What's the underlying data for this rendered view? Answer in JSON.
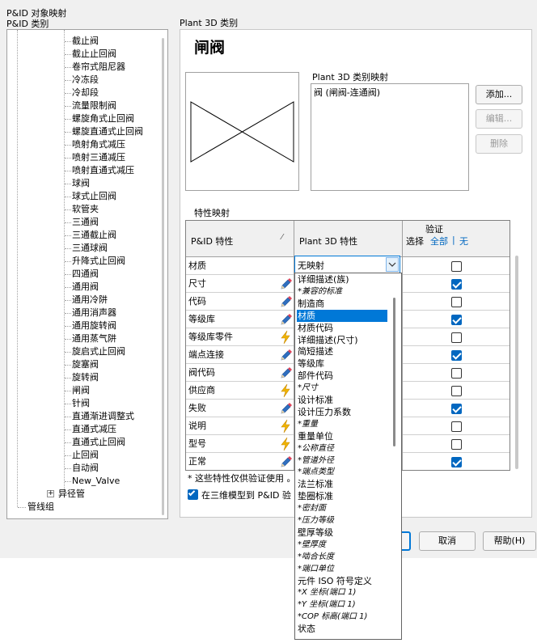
{
  "window": {
    "title": "P&ID 对象映射"
  },
  "left": {
    "header": "P&ID 类别",
    "tree_items": [
      "截止阀",
      "截止止回阀",
      "卷帘式阻尼器",
      "冷冻段",
      "冷却段",
      "流量限制阀",
      "螺旋角式止回阀",
      "螺旋直通式止回阀",
      "喷射角式减压",
      "喷射三通减压",
      "喷射直通式减压",
      "球阀",
      "球式止回阀",
      "软管夹",
      "三通阀",
      "三通截止阀",
      "三通球阀",
      "升降式止回阀",
      "四通阀",
      "通用阀",
      "通用冷阱",
      "通用消声器",
      "通用旋转阀",
      "通用蒸气阱",
      "旋启式止回阀",
      "旋塞阀",
      "旋转阀",
      "闸阀",
      "针阀",
      "直通渐进调整式",
      "直通式减压",
      "直通式止回阀",
      "止回阀",
      "自动阀",
      "New_Valve"
    ],
    "reducer": "异径管",
    "pipeline_group": "管线组",
    "expand_symbol": "+"
  },
  "right": {
    "header": "Plant 3D 类别",
    "class_title": "闸阀",
    "mapping_label": "Plant 3D 类别映射",
    "mapping_items": [
      "阀 (闸阀-连通阀)"
    ],
    "buttons": {
      "add": "添加...",
      "edit": "编辑...",
      "delete": "删除"
    },
    "prop_mapping_label": "特性映射",
    "grid": {
      "col1": "P&ID 特性",
      "col2": "Plant 3D 特性",
      "col3": "验证",
      "select_label": "选择",
      "select_all": "全部",
      "select_sep": "|",
      "select_none": "无",
      "rows": [
        {
          "name": "材质",
          "icon": "",
          "checked": false
        },
        {
          "name": "尺寸",
          "icon": "pencil-icon",
          "checked": true
        },
        {
          "name": "代码",
          "icon": "pencil-icon",
          "checked": false
        },
        {
          "name": "等级库",
          "icon": "pencil-icon",
          "checked": true
        },
        {
          "name": "等级库零件",
          "icon": "lightning-icon",
          "checked": false
        },
        {
          "name": "端点连接",
          "icon": "pencil-icon",
          "checked": true
        },
        {
          "name": "阀代码",
          "icon": "pencil-icon",
          "checked": false
        },
        {
          "name": "供应商",
          "icon": "lightning-icon",
          "checked": false
        },
        {
          "name": "失败",
          "icon": "pencil-icon",
          "checked": true
        },
        {
          "name": "说明",
          "icon": "lightning-icon",
          "checked": false
        },
        {
          "name": "型号",
          "icon": "lightning-icon",
          "checked": false
        },
        {
          "name": "正常",
          "icon": "pencil-icon",
          "checked": true
        }
      ]
    },
    "combo_value": "无映射",
    "dropdown_items": [
      {
        "text": "详细描述(族)",
        "italic": false
      },
      {
        "text": "*兼容的标准",
        "italic": true
      },
      {
        "text": "制造商",
        "italic": false
      },
      {
        "text": "材质",
        "italic": false,
        "selected": true
      },
      {
        "text": "材质代码",
        "italic": false
      },
      {
        "text": "详细描述(尺寸)",
        "italic": false
      },
      {
        "text": "简短描述",
        "italic": false
      },
      {
        "text": "等级库",
        "italic": false
      },
      {
        "text": "部件代码",
        "italic": false
      },
      {
        "text": "*尺寸",
        "italic": true
      },
      {
        "text": "设计标准",
        "italic": false
      },
      {
        "text": "设计压力系数",
        "italic": false
      },
      {
        "text": "*重量",
        "italic": true
      },
      {
        "text": "重量单位",
        "italic": false
      },
      {
        "text": "*公称直径",
        "italic": true
      },
      {
        "text": "*管道外径",
        "italic": true
      },
      {
        "text": "*端点类型",
        "italic": true
      },
      {
        "text": "法兰标准",
        "italic": false
      },
      {
        "text": "垫圈标准",
        "italic": false
      },
      {
        "text": "*密封面",
        "italic": true
      },
      {
        "text": "*压力等级",
        "italic": true
      },
      {
        "text": "壁厚等级",
        "italic": false
      },
      {
        "text": "*壁厚度",
        "italic": true
      },
      {
        "text": "*啮合长度",
        "italic": true
      },
      {
        "text": "*端口单位",
        "italic": true
      },
      {
        "text": "元件 ISO 符号定义",
        "italic": false
      },
      {
        "text": "*X 坐标(端口 1)",
        "italic": true
      },
      {
        "text": "*Y 坐标(端口 1)",
        "italic": true
      },
      {
        "text": "*COP 标高(端口 1)",
        "italic": true
      },
      {
        "text": "状态",
        "italic": false
      }
    ],
    "footnote": "* 这些特性仅供验证使用 。",
    "checkbox_label": "在三维模型到 P&ID 验",
    "checkbox_checked": true
  },
  "footer": {
    "cancel": "取消",
    "help": "帮助(H)"
  },
  "colors": {
    "accent": "#0078d7",
    "pencil": "#2f6fc0",
    "lightning": "#f0b400"
  }
}
